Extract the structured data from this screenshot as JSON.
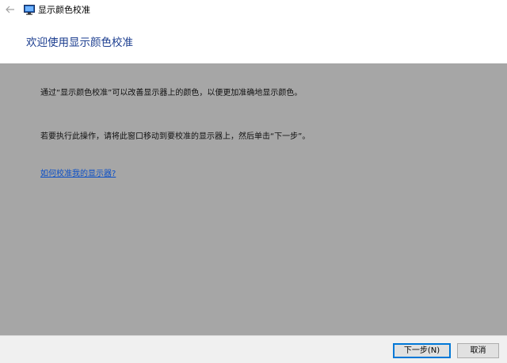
{
  "window": {
    "title": "显示颜色校准",
    "back_icon": "back-arrow-icon",
    "app_icon": "display-monitor-icon"
  },
  "header": {
    "title": "欢迎使用显示颜色校准"
  },
  "main": {
    "paragraph1": "通过“显示颜色校准”可以改善显示器上的颜色，以便更加准确地显示颜色。",
    "paragraph2": "若要执行此操作，请将此窗口移动到要校准的显示器上，然后单击“下一步”。",
    "help_link": "如何校准我的显示器?",
    "background_color": "#a6a6a6"
  },
  "footer": {
    "next_label": "下一步(N)",
    "next_accesskey": "N",
    "cancel_label": "取消"
  },
  "colors": {
    "header_title": "#1b3d8f",
    "link": "#0b4fc7",
    "focus_border": "#0078d7"
  }
}
